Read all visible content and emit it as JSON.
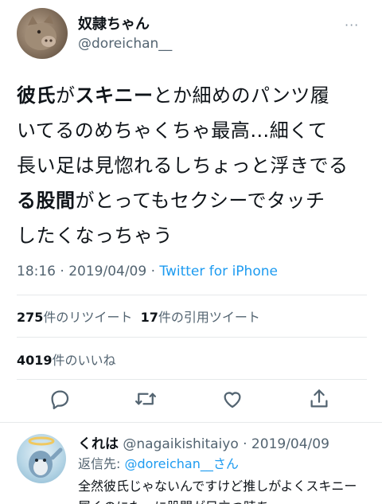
{
  "author": {
    "display_name": "奴隷ちゃん",
    "handle": "@doreichan__"
  },
  "more_label": "···",
  "tweet": {
    "line1": {
      "p1": "彼氏",
      "p2": "が",
      "p3": "スキニー",
      "p4": "とか細めのパンツ履"
    },
    "line2": "いてるのめちゃくちゃ最高…細くて",
    "line3": "長い足は見惚れるしちょっと浮きでる",
    "line4": {
      "p1": "る",
      "p2": "股間",
      "p3": "がとってもセクシーでタッチ"
    },
    "line5": "したくなっちゃう"
  },
  "meta": {
    "time": "18:16 · 2019/04/09 · ",
    "source": "Twitter for iPhone"
  },
  "stats": {
    "retweets_count": "275",
    "retweets_label": "件のリツイート",
    "quotes_count": "17",
    "quotes_label": "件の引用ツイート",
    "likes_count": "4019",
    "likes_label": "件のいいね"
  },
  "actions": [
    "reply-icon",
    "retweet-icon",
    "like-icon",
    "share-icon"
  ],
  "reply": {
    "name": "くれは",
    "handle_date": "@nagaikishitaiyo · 2019/04/09",
    "reply_prefix": "返信先: ",
    "reply_to": "@doreichan__さん",
    "text": "全然彼氏じゃないんですけど推しがよくスキニー履くのにた～に股間が目立つ時あ"
  },
  "colors": {
    "accent": "#1d9bf0",
    "muted": "#536471"
  }
}
